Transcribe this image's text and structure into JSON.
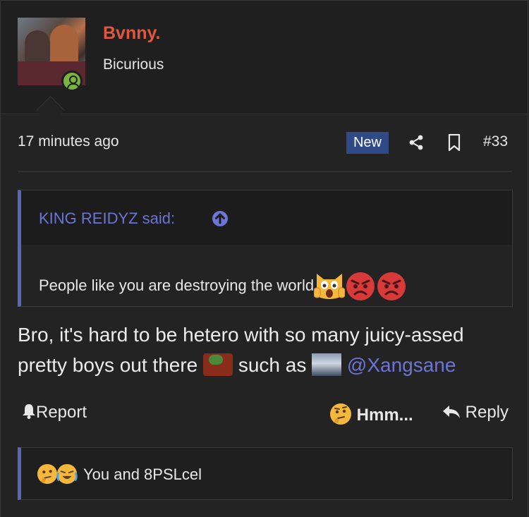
{
  "user": {
    "name": "Bvnny.",
    "title": "Bicurious"
  },
  "meta": {
    "time": "17 minutes ago",
    "badge": "New",
    "post_number": "#33"
  },
  "quote": {
    "author": "KING REIDYZ said:",
    "body": "People like you are destroying the world"
  },
  "reply": {
    "part1": "Bro, it's hard to be hetero with so many juicy-assed pretty boys out there",
    "part2": "such as",
    "mention": "@Xangsane"
  },
  "actions": {
    "report": "Report",
    "hmm": "Hmm...",
    "reply": "Reply"
  },
  "reactions": {
    "summary": "You and 8PSLcel"
  },
  "icons": [
    "bell-icon",
    "share-icon",
    "bookmark-icon",
    "arrow-up-circle-icon",
    "reply-arrow-icon",
    "thinking-face-icon",
    "crying-face-icon",
    "scared-cat-icon",
    "angry-face-icon"
  ],
  "colors": {
    "username": "#e0583e",
    "accent": "#6b75d6",
    "badge_bg": "#2f4a86",
    "online": "#7cb342"
  }
}
